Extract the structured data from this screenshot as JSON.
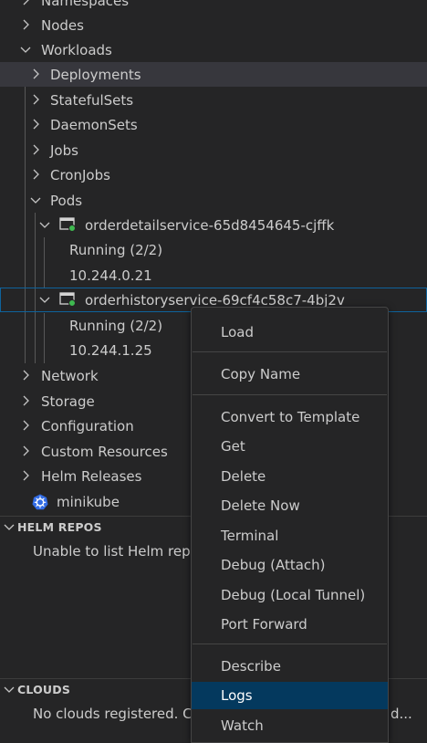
{
  "tree": {
    "namespaces": "Namespaces",
    "nodes": "Nodes",
    "workloads": "Workloads",
    "deployments": "Deployments",
    "statefulsets": "StatefulSets",
    "daemonsets": "DaemonSets",
    "jobs": "Jobs",
    "cronjobs": "CronJobs",
    "pods": "Pods",
    "pod1": {
      "name": "orderdetailservice-65d8454645-cjffk",
      "status": "Running (2/2)",
      "ip": "10.244.0.21"
    },
    "pod2": {
      "name": "orderhistoryservice-69cf4c58c7-4bj2v",
      "status": "Running (2/2)",
      "ip": "10.244.1.25"
    },
    "network": "Network",
    "storage": "Storage",
    "configuration": "Configuration",
    "custom_resources": "Custom Resources",
    "helm_releases": "Helm Releases",
    "cluster": "minikube"
  },
  "helm_repos": {
    "title": "HELM REPOS",
    "message": "Unable to list Helm repo"
  },
  "clouds": {
    "title": "CLOUDS",
    "message": "No clouds registered. Cli",
    "message_tail": "d..."
  },
  "context_menu": {
    "load": "Load",
    "copy_name": "Copy Name",
    "convert_to_template": "Convert to Template",
    "get": "Get",
    "delete": "Delete",
    "delete_now": "Delete Now",
    "terminal": "Terminal",
    "debug_attach": "Debug (Attach)",
    "debug_local_tunnel": "Debug (Local Tunnel)",
    "port_forward": "Port Forward",
    "describe": "Describe",
    "logs": "Logs",
    "watch": "Watch"
  },
  "colors": {
    "background": "#252526",
    "menu_highlight": "#04395e",
    "focus_border": "#0e639c",
    "pod_running": "#3fb950"
  }
}
